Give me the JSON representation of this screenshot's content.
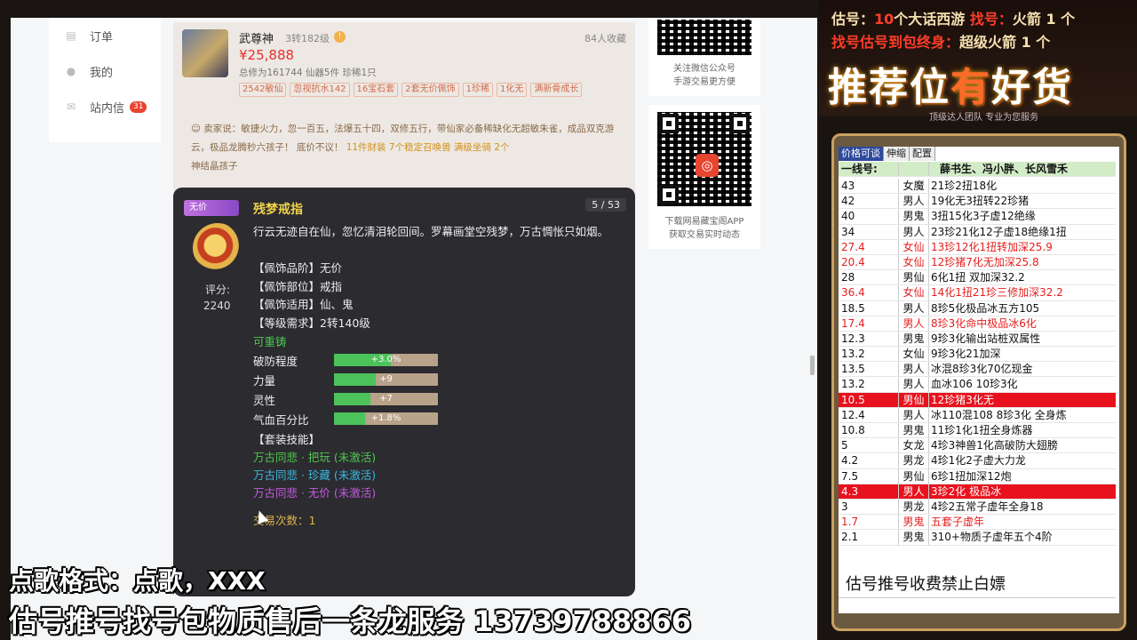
{
  "sidebar": {
    "items": [
      {
        "icon": "clipboard-icon",
        "label": "订单"
      },
      {
        "icon": "user-icon",
        "label": "我的"
      },
      {
        "icon": "mail-icon",
        "label": "站内信",
        "badge": "31"
      }
    ]
  },
  "listing": {
    "name": "武尊神",
    "level": "3转182级",
    "info": "!",
    "favorites": "84人收藏",
    "price": "¥25,888",
    "meta": "总修为161744  仙器5件  珍稀1只",
    "tags": [
      "2542敏仙",
      "忽视抗水142",
      "16宝石套",
      "2套无价佩饰",
      "1珍稀",
      "1化无",
      "满新骨成长"
    ],
    "desc_prefix": "卖家说：敏捷火力，忽一百五，法爆五十四，双修五行，带仙家必备稀缺化无超敏朱雀，成品双克游云，极品龙腾秒六孩子！  底价不议！",
    "desc_highlight": "11件财装 7个稳定召唤兽 满级坐骑 2个",
    "desc_suffix": "神结晶孩子"
  },
  "tooltip": {
    "tag": "无价",
    "title": "残梦戒指",
    "page": "5 / 53",
    "score_label": "评分:",
    "score_value": "2240",
    "desc": "行云无迹自在仙，忽忆清泪轮回间。罗幕画堂空残梦，万古惆怅只如烟。",
    "attrs": [
      "【佩饰品阶】无价",
      "【佩饰部位】戒指",
      "【佩饰适用】仙、鬼",
      "【等级需求】2转140级"
    ],
    "recast": "可重铸",
    "stats": [
      {
        "label": "破防程度",
        "text": "+3.0%",
        "fill": 0.55
      },
      {
        "label": "力量",
        "text": "+9",
        "fill": 0.4
      },
      {
        "label": "灵性",
        "text": "+7",
        "fill": 0.35
      },
      {
        "label": "气血百分比",
        "text": "+1.8%",
        "fill": 0.3
      }
    ],
    "set_label": "【套装技能】",
    "sets": [
      {
        "text": "万古同悲 · 把玩 (未激活)",
        "color": "#4ec84e"
      },
      {
        "text": "万古同悲 · 珍藏 (未激活)",
        "color": "#3bb8e0"
      },
      {
        "text": "万古同悲 · 无价 (未激活)",
        "color": "#c55ae0"
      }
    ],
    "trade": "交易次数：1"
  },
  "qr": [
    {
      "caption": "关注微信公众号\n手游交易更方便"
    },
    {
      "caption": "下载网易藏宝阁APP\n获取交易实时动态"
    }
  ],
  "promo": {
    "line1_a": "估号：",
    "line1_b": "10",
    "line1_c": "个大话西游 ",
    "line1_d": "找号：",
    "line1_e": "火箭 1 个",
    "line2_a": "找号估号到包终身：",
    "line2_b": "超级火箭 1 个",
    "big_a": "推荐",
    "big_b": "位",
    "big_c": "有",
    "big_d": "好货",
    "sub": "顶级达人团队  专业为您服务"
  },
  "sheet": {
    "tabs": [
      "价格可谈",
      "伸缩",
      "配置"
    ],
    "head_c1": "一线号:",
    "head_c3": "薛书生、冯小胖、长风雪禾",
    "rows": [
      [
        "43",
        "女魔",
        "21珍2扭18化",
        ""
      ],
      [
        "42",
        "男人",
        "19化无3扭转22珍猪",
        ""
      ],
      [
        "40",
        "男鬼",
        "3扭15化3子虚12绝缘",
        ""
      ],
      [
        "34",
        "男人",
        "23珍21化12子虚18绝缘1扭",
        ""
      ],
      [
        "27.4",
        "女仙",
        "13珍12化1扭转加深25.9",
        "red"
      ],
      [
        "20.4",
        "女仙",
        "12珍猪7化无加深25.8",
        "red"
      ],
      [
        "28",
        "男仙",
        "6化1扭 双加深32.2",
        ""
      ],
      [
        "36.4",
        "女仙",
        "14化1扭21珍三修加深32.2",
        "red"
      ],
      [
        "18.5",
        "男人",
        "8珍5化极品冰五方105",
        ""
      ],
      [
        "17.4",
        "男人",
        "8珍3化命中极品冰6化",
        "red"
      ],
      [
        "12.3",
        "男鬼",
        "9珍3化输出站桩双属性",
        ""
      ],
      [
        "13.2",
        "女仙",
        "9珍3化21加深",
        ""
      ],
      [
        "13.5",
        "男人",
        "冰混8珍3化70亿现金",
        ""
      ],
      [
        "13.2",
        "男人",
        "血冰106  10珍3化",
        ""
      ],
      [
        "10.5",
        "男仙",
        "12珍猪3化无",
        "hl"
      ],
      [
        "12.4",
        "男人",
        "冰110混108  8珍3化  全身炼",
        ""
      ],
      [
        "10.8",
        "男鬼",
        "11珍1化1扭全身炼器",
        ""
      ],
      [
        "5",
        "女龙",
        "4珍3神兽1化高破防大翅膀",
        ""
      ],
      [
        "4.2",
        "男龙",
        "4珍1化2子虚大力龙",
        ""
      ],
      [
        "7.5",
        "男仙",
        "6珍1扭加深12炮",
        ""
      ],
      [
        "4.3",
        "男人",
        "3珍2化  极品冰",
        "hl"
      ],
      [
        "3",
        "男龙",
        "4珍2五常子虚年全身18",
        ""
      ],
      [
        "1.7",
        "男鬼",
        "五套子虚年",
        "red"
      ],
      [
        "2.1",
        "男鬼",
        "310+物质子虚年五个4阶",
        ""
      ]
    ],
    "footer": "估号推号收费禁止白嫖"
  },
  "overlay": {
    "line1": "点歌格式：点歌，XXX",
    "line2": "估号推号找号包物质售后一条龙服务 13739788866"
  }
}
